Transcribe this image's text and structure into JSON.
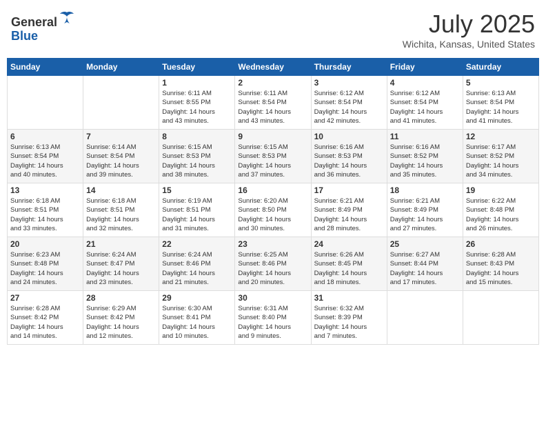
{
  "header": {
    "logo_line1": "General",
    "logo_line2": "Blue",
    "month_year": "July 2025",
    "location": "Wichita, Kansas, United States"
  },
  "days_of_week": [
    "Sunday",
    "Monday",
    "Tuesday",
    "Wednesday",
    "Thursday",
    "Friday",
    "Saturday"
  ],
  "weeks": [
    [
      {
        "day": null,
        "info": null
      },
      {
        "day": null,
        "info": null
      },
      {
        "day": "1",
        "info": "Sunrise: 6:11 AM\nSunset: 8:55 PM\nDaylight: 14 hours\nand 43 minutes."
      },
      {
        "day": "2",
        "info": "Sunrise: 6:11 AM\nSunset: 8:54 PM\nDaylight: 14 hours\nand 43 minutes."
      },
      {
        "day": "3",
        "info": "Sunrise: 6:12 AM\nSunset: 8:54 PM\nDaylight: 14 hours\nand 42 minutes."
      },
      {
        "day": "4",
        "info": "Sunrise: 6:12 AM\nSunset: 8:54 PM\nDaylight: 14 hours\nand 41 minutes."
      },
      {
        "day": "5",
        "info": "Sunrise: 6:13 AM\nSunset: 8:54 PM\nDaylight: 14 hours\nand 41 minutes."
      }
    ],
    [
      {
        "day": "6",
        "info": "Sunrise: 6:13 AM\nSunset: 8:54 PM\nDaylight: 14 hours\nand 40 minutes."
      },
      {
        "day": "7",
        "info": "Sunrise: 6:14 AM\nSunset: 8:54 PM\nDaylight: 14 hours\nand 39 minutes."
      },
      {
        "day": "8",
        "info": "Sunrise: 6:15 AM\nSunset: 8:53 PM\nDaylight: 14 hours\nand 38 minutes."
      },
      {
        "day": "9",
        "info": "Sunrise: 6:15 AM\nSunset: 8:53 PM\nDaylight: 14 hours\nand 37 minutes."
      },
      {
        "day": "10",
        "info": "Sunrise: 6:16 AM\nSunset: 8:53 PM\nDaylight: 14 hours\nand 36 minutes."
      },
      {
        "day": "11",
        "info": "Sunrise: 6:16 AM\nSunset: 8:52 PM\nDaylight: 14 hours\nand 35 minutes."
      },
      {
        "day": "12",
        "info": "Sunrise: 6:17 AM\nSunset: 8:52 PM\nDaylight: 14 hours\nand 34 minutes."
      }
    ],
    [
      {
        "day": "13",
        "info": "Sunrise: 6:18 AM\nSunset: 8:51 PM\nDaylight: 14 hours\nand 33 minutes."
      },
      {
        "day": "14",
        "info": "Sunrise: 6:18 AM\nSunset: 8:51 PM\nDaylight: 14 hours\nand 32 minutes."
      },
      {
        "day": "15",
        "info": "Sunrise: 6:19 AM\nSunset: 8:51 PM\nDaylight: 14 hours\nand 31 minutes."
      },
      {
        "day": "16",
        "info": "Sunrise: 6:20 AM\nSunset: 8:50 PM\nDaylight: 14 hours\nand 30 minutes."
      },
      {
        "day": "17",
        "info": "Sunrise: 6:21 AM\nSunset: 8:49 PM\nDaylight: 14 hours\nand 28 minutes."
      },
      {
        "day": "18",
        "info": "Sunrise: 6:21 AM\nSunset: 8:49 PM\nDaylight: 14 hours\nand 27 minutes."
      },
      {
        "day": "19",
        "info": "Sunrise: 6:22 AM\nSunset: 8:48 PM\nDaylight: 14 hours\nand 26 minutes."
      }
    ],
    [
      {
        "day": "20",
        "info": "Sunrise: 6:23 AM\nSunset: 8:48 PM\nDaylight: 14 hours\nand 24 minutes."
      },
      {
        "day": "21",
        "info": "Sunrise: 6:24 AM\nSunset: 8:47 PM\nDaylight: 14 hours\nand 23 minutes."
      },
      {
        "day": "22",
        "info": "Sunrise: 6:24 AM\nSunset: 8:46 PM\nDaylight: 14 hours\nand 21 minutes."
      },
      {
        "day": "23",
        "info": "Sunrise: 6:25 AM\nSunset: 8:46 PM\nDaylight: 14 hours\nand 20 minutes."
      },
      {
        "day": "24",
        "info": "Sunrise: 6:26 AM\nSunset: 8:45 PM\nDaylight: 14 hours\nand 18 minutes."
      },
      {
        "day": "25",
        "info": "Sunrise: 6:27 AM\nSunset: 8:44 PM\nDaylight: 14 hours\nand 17 minutes."
      },
      {
        "day": "26",
        "info": "Sunrise: 6:28 AM\nSunset: 8:43 PM\nDaylight: 14 hours\nand 15 minutes."
      }
    ],
    [
      {
        "day": "27",
        "info": "Sunrise: 6:28 AM\nSunset: 8:42 PM\nDaylight: 14 hours\nand 14 minutes."
      },
      {
        "day": "28",
        "info": "Sunrise: 6:29 AM\nSunset: 8:42 PM\nDaylight: 14 hours\nand 12 minutes."
      },
      {
        "day": "29",
        "info": "Sunrise: 6:30 AM\nSunset: 8:41 PM\nDaylight: 14 hours\nand 10 minutes."
      },
      {
        "day": "30",
        "info": "Sunrise: 6:31 AM\nSunset: 8:40 PM\nDaylight: 14 hours\nand 9 minutes."
      },
      {
        "day": "31",
        "info": "Sunrise: 6:32 AM\nSunset: 8:39 PM\nDaylight: 14 hours\nand 7 minutes."
      },
      {
        "day": null,
        "info": null
      },
      {
        "day": null,
        "info": null
      }
    ]
  ]
}
